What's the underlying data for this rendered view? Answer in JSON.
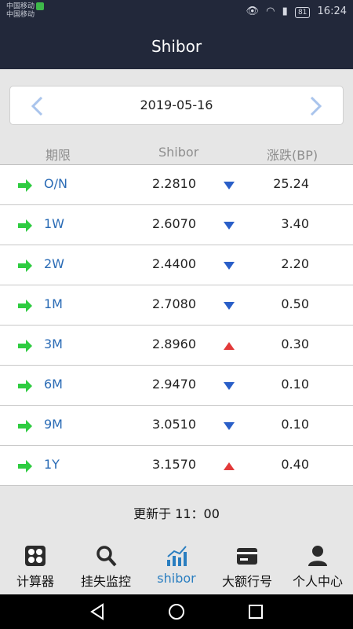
{
  "status_bar": {
    "carrier_1": "中国移动",
    "carrier_2": "中国移动",
    "battery": "81",
    "time": "16:24"
  },
  "header": {
    "title": "Shibor"
  },
  "date_bar": {
    "date": "2019-05-16",
    "prev_icon": "chevron-left-icon",
    "next_icon": "chevron-right-icon"
  },
  "columns": {
    "term": "期限",
    "shibor": "Shibor",
    "change": "涨跌(BP)"
  },
  "rows": [
    {
      "term": "O/N",
      "rate": "2.2810",
      "trend": "down",
      "bp": "25.24"
    },
    {
      "term": "1W",
      "rate": "2.6070",
      "trend": "down",
      "bp": "3.40"
    },
    {
      "term": "2W",
      "rate": "2.4400",
      "trend": "down",
      "bp": "2.20"
    },
    {
      "term": "1M",
      "rate": "2.7080",
      "trend": "down",
      "bp": "0.50"
    },
    {
      "term": "3M",
      "rate": "2.8960",
      "trend": "up",
      "bp": "0.30"
    },
    {
      "term": "6M",
      "rate": "2.9470",
      "trend": "down",
      "bp": "0.10"
    },
    {
      "term": "9M",
      "rate": "3.0510",
      "trend": "down",
      "bp": "0.10"
    },
    {
      "term": "1Y",
      "rate": "3.1570",
      "trend": "up",
      "bp": "0.40"
    }
  ],
  "updated_text": "更新于 11：00",
  "tabs": [
    {
      "label": "计算器",
      "icon": "calculator-icon",
      "active": false
    },
    {
      "label": "挂失监控",
      "icon": "search-icon",
      "active": false
    },
    {
      "label": "shibor",
      "icon": "chart-icon",
      "active": true
    },
    {
      "label": "大额行号",
      "icon": "card-icon",
      "active": false
    },
    {
      "label": "个人中心",
      "icon": "person-icon",
      "active": false
    }
  ],
  "colors": {
    "header_bg": "#22283a",
    "accent": "#2a7ec0",
    "arrow_green": "#2ecc40",
    "trend_down": "#2a5fc8",
    "trend_up": "#e23a3a"
  }
}
